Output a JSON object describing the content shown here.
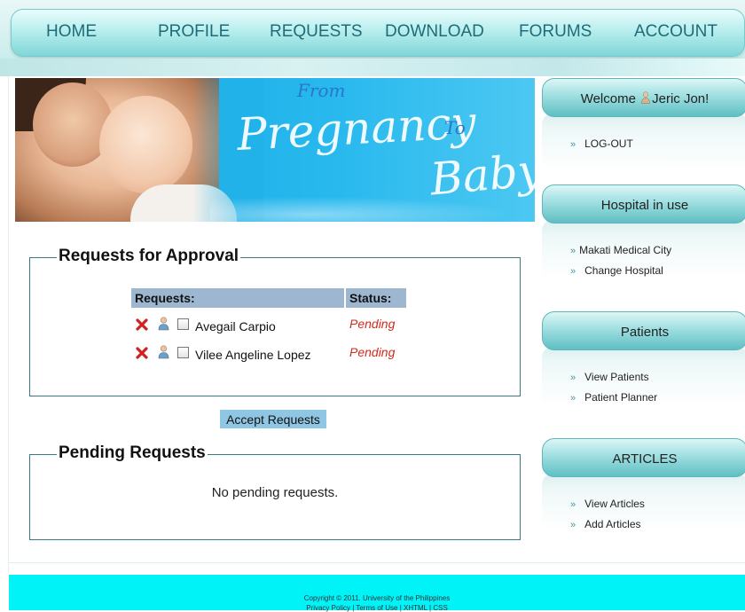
{
  "nav": {
    "items": [
      "HOME",
      "PROFILE",
      "REQUESTS",
      "DOWNLOAD",
      "FORUMS",
      "ACCOUNT"
    ]
  },
  "banner": {
    "from": "From",
    "pregnancy": "Pregnancy",
    "to": "To",
    "baby": "Baby"
  },
  "approval": {
    "title": "Requests for Approval",
    "col_requests": "Requests:",
    "col_status": "Status:",
    "rows": [
      {
        "name": "Avegail Carpio",
        "status": "Pending"
      },
      {
        "name": "Vilee Angeline Lopez",
        "status": "Pending"
      }
    ],
    "accept_button": "Accept Requests"
  },
  "pending": {
    "title": "Pending Requests",
    "empty_text": "No pending requests."
  },
  "sidebar": {
    "welcome_prefix": "Welcome",
    "welcome_user": "Jeric Jon!",
    "logout": "LOG-OUT",
    "hospital_title": "Hospital in use",
    "hospital_name": "Makati Medical City",
    "change_hospital": "Change Hospital",
    "patients_title": "Patients",
    "view_patients": "View Patients",
    "patient_planner": "Patient Planner",
    "articles_title": "ARTICLES",
    "view_articles": "View Articles",
    "add_articles": "Add Articles"
  },
  "footer": {
    "copyright": "Copyright © 2011. University of the Philippines",
    "links": "Privacy Policy | Terms of Use | XHTML | CSS"
  },
  "colors": {
    "status_pending": "#d12a1c",
    "table_header": "#9cb7cf",
    "accent_teal": "#1f6c78",
    "footer_bg": "#00f3f7"
  },
  "icons": {
    "delete": "x-icon",
    "user": "user-icon",
    "bullet": "chevron-double-right-icon"
  }
}
